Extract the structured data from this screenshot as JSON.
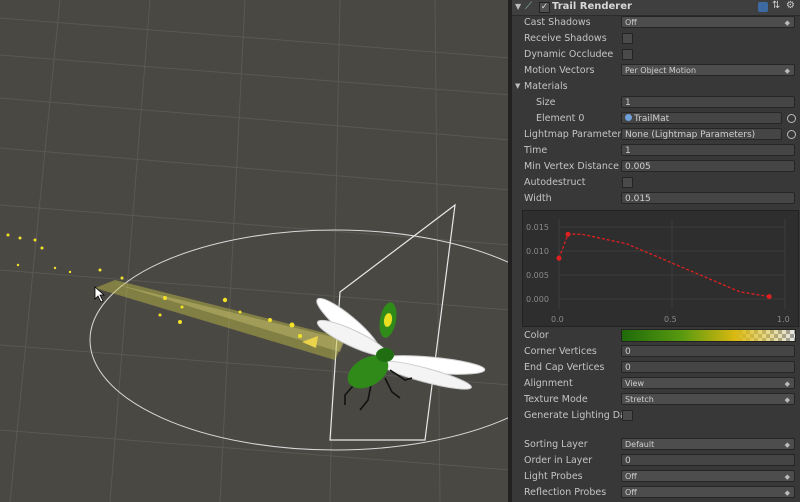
{
  "component": {
    "title": "Trail Renderer",
    "enabled": true,
    "icons": [
      "book-icon",
      "settings-cog-icon",
      "gear-icon"
    ]
  },
  "properties": {
    "cast_shadows": {
      "label": "Cast Shadows",
      "value": "Off"
    },
    "receive_shadows": {
      "label": "Receive Shadows",
      "checked": false
    },
    "dynamic_occludee": {
      "label": "Dynamic Occludee",
      "checked": false
    },
    "motion_vectors": {
      "label": "Motion Vectors",
      "value": "Per Object Motion"
    },
    "materials": {
      "label": "Materials"
    },
    "size": {
      "label": "Size",
      "value": "1"
    },
    "element0": {
      "label": "Element 0",
      "value": "TrailMat"
    },
    "lightmap_parameters": {
      "label": "Lightmap Parameters",
      "value": "None (Lightmap Parameters)"
    },
    "time": {
      "label": "Time",
      "value": "1"
    },
    "min_vertex_distance": {
      "label": "Min Vertex Distance",
      "value": "0.005"
    },
    "autodestruct": {
      "label": "Autodestruct",
      "checked": false
    },
    "width": {
      "label": "Width",
      "value": "0.015"
    },
    "color": {
      "label": "Color"
    },
    "corner_vertices": {
      "label": "Corner Vertices",
      "value": "0"
    },
    "end_cap_vertices": {
      "label": "End Cap Vertices",
      "value": "0"
    },
    "alignment": {
      "label": "Alignment",
      "value": "View"
    },
    "texture_mode": {
      "label": "Texture Mode",
      "value": "Stretch"
    },
    "generate_lighting_data": {
      "label": "Generate Lighting Dat",
      "checked": false
    },
    "sorting_layer": {
      "label": "Sorting Layer",
      "value": "Default"
    },
    "order_in_layer": {
      "label": "Order in Layer",
      "value": "0"
    },
    "light_probes": {
      "label": "Light Probes",
      "value": "Off"
    },
    "reflection_probes": {
      "label": "Reflection Probes",
      "value": "Off"
    }
  },
  "width_curve": {
    "y_labels": [
      "0.015",
      "0.010",
      "0.005",
      "0.000"
    ],
    "x_labels": [
      "0.0",
      "0.5",
      "1.0"
    ],
    "y_ticks": [
      0.015,
      0.01,
      0.005,
      0.0
    ],
    "x_ticks": [
      0.0,
      0.5,
      1.0
    ],
    "xlim": [
      0.0,
      1.0
    ],
    "ylim": [
      0.0,
      0.015
    ],
    "curve_color": "#e02020",
    "points": [
      {
        "t": 0.0,
        "w": 0.0085
      },
      {
        "t": 0.04,
        "w": 0.0135
      },
      {
        "t": 0.1,
        "w": 0.0135
      },
      {
        "t": 0.3,
        "w": 0.0115
      },
      {
        "t": 0.6,
        "w": 0.0055
      },
      {
        "t": 0.8,
        "w": 0.0015
      },
      {
        "t": 0.93,
        "w": 0.0005
      }
    ],
    "keys": [
      {
        "t": 0.0,
        "w": 0.0085
      },
      {
        "t": 0.04,
        "w": 0.0135
      },
      {
        "t": 0.93,
        "w": 0.0005
      }
    ]
  },
  "color_gradient": [
    "#1e6a0a",
    "#5a9a10",
    "#d9b810",
    "#e6c828"
  ],
  "scene": {
    "bug_body_color": "#2f8a1a",
    "trail_color": "#c8c34a",
    "gizmo_color": "#e6e6e6"
  }
}
